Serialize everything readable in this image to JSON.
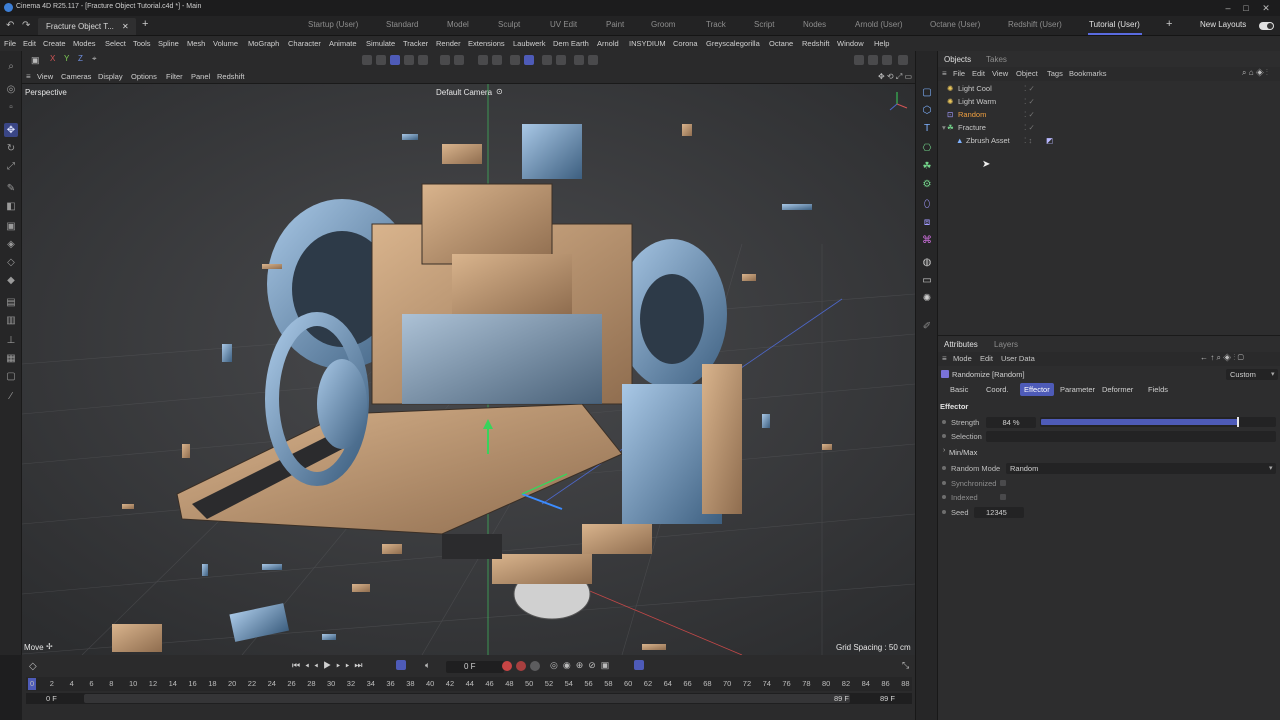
{
  "app": {
    "title": "Cinema 4D R25.117 - [Fracture Object Tutorial.c4d *] - Main",
    "doc_tab": "Fracture Object T...",
    "window_controls": [
      "–",
      "□",
      "✕"
    ]
  },
  "layouts": {
    "tabs": [
      "Startup (User)",
      "Standard",
      "Model",
      "Sculpt",
      "UV Edit",
      "Paint",
      "Groom",
      "Track",
      "Script",
      "Nodes",
      "Arnold (User)",
      "Octane (User)",
      "Redshift (User)",
      "Tutorial (User)"
    ],
    "active": "Tutorial (User)",
    "new_layouts": "New Layouts"
  },
  "menubar": [
    "File",
    "Edit",
    "Create",
    "Modes",
    "Select",
    "Tools",
    "Spline",
    "Mesh",
    "Volume",
    "MoGraph",
    "Character",
    "Animate",
    "Simulate",
    "Tracker",
    "Render",
    "Extensions",
    "Laubwerk",
    "Dem Earth",
    "Arnold",
    "INSYDIUM",
    "Corona",
    "Greyscalegorilla",
    "Octane",
    "Redshift",
    "Window",
    "Help"
  ],
  "viewport": {
    "menu": [
      "View",
      "Cameras",
      "Display",
      "Options",
      "Filter",
      "Panel",
      "Redshift"
    ],
    "label": "Perspective",
    "camera": "Default Camera",
    "camera_icon": "camera-icon",
    "grid_spacing": "Grid Spacing : 50 cm",
    "mode": "Move"
  },
  "timeline": {
    "frame_field": "0 F",
    "ticks": [
      "0",
      "2",
      "4",
      "6",
      "8",
      "10",
      "12",
      "14",
      "16",
      "18",
      "20",
      "22",
      "24",
      "26",
      "28",
      "30",
      "32",
      "34",
      "36",
      "38",
      "40",
      "42",
      "44",
      "46",
      "48",
      "50",
      "52",
      "54",
      "56",
      "58",
      "60",
      "62",
      "64",
      "66",
      "68",
      "70",
      "72",
      "74",
      "76",
      "78",
      "80",
      "82",
      "84",
      "86",
      "88"
    ],
    "start": "0 F",
    "start2": "0 F",
    "end": "89 F",
    "end2": "89 F"
  },
  "objects": {
    "tabs": [
      "Objects",
      "Takes"
    ],
    "menu": [
      "File",
      "Edit",
      "View",
      "Object",
      "Tags",
      "Bookmarks"
    ],
    "items": [
      {
        "name": "Light Cool",
        "color": "#c8c8c8",
        "icon": "light-icon",
        "indent": 0
      },
      {
        "name": "Light Warm",
        "color": "#c8c8c8",
        "icon": "light-icon",
        "indent": 0
      },
      {
        "name": "Random",
        "color": "#f0a040",
        "icon": "random-effector-icon",
        "indent": 0
      },
      {
        "name": "Fracture",
        "color": "#c8c8c8",
        "icon": "fracture-icon",
        "indent": 0
      },
      {
        "name": "Zbrush Asset",
        "color": "#c8c8c8",
        "icon": "polygon-object-icon",
        "indent": 1
      }
    ]
  },
  "attributes": {
    "tabs": [
      "Attributes",
      "Layers"
    ],
    "menu": [
      "Mode",
      "Edit",
      "User Data"
    ],
    "object_title": "Randomize [Random]",
    "preset": "Custom",
    "subtabs": [
      "Basic",
      "Coord.",
      "Effector",
      "Parameter",
      "Deformer",
      "Fields"
    ],
    "active_subtab": "Effector",
    "section": "Effector",
    "strength_label": "Strength",
    "strength_value": "84 %",
    "strength_fraction": 0.84,
    "selection_label": "Selection",
    "minmax_label": "Min/Max",
    "random_mode_label": "Random Mode",
    "random_mode_value": "Random",
    "synchronized_label": "Synchronized",
    "indexed_label": "Indexed",
    "seed_label": "Seed",
    "seed_value": "12345"
  },
  "colors": {
    "accent": "#5a6be0",
    "orange": "#f0a040"
  }
}
